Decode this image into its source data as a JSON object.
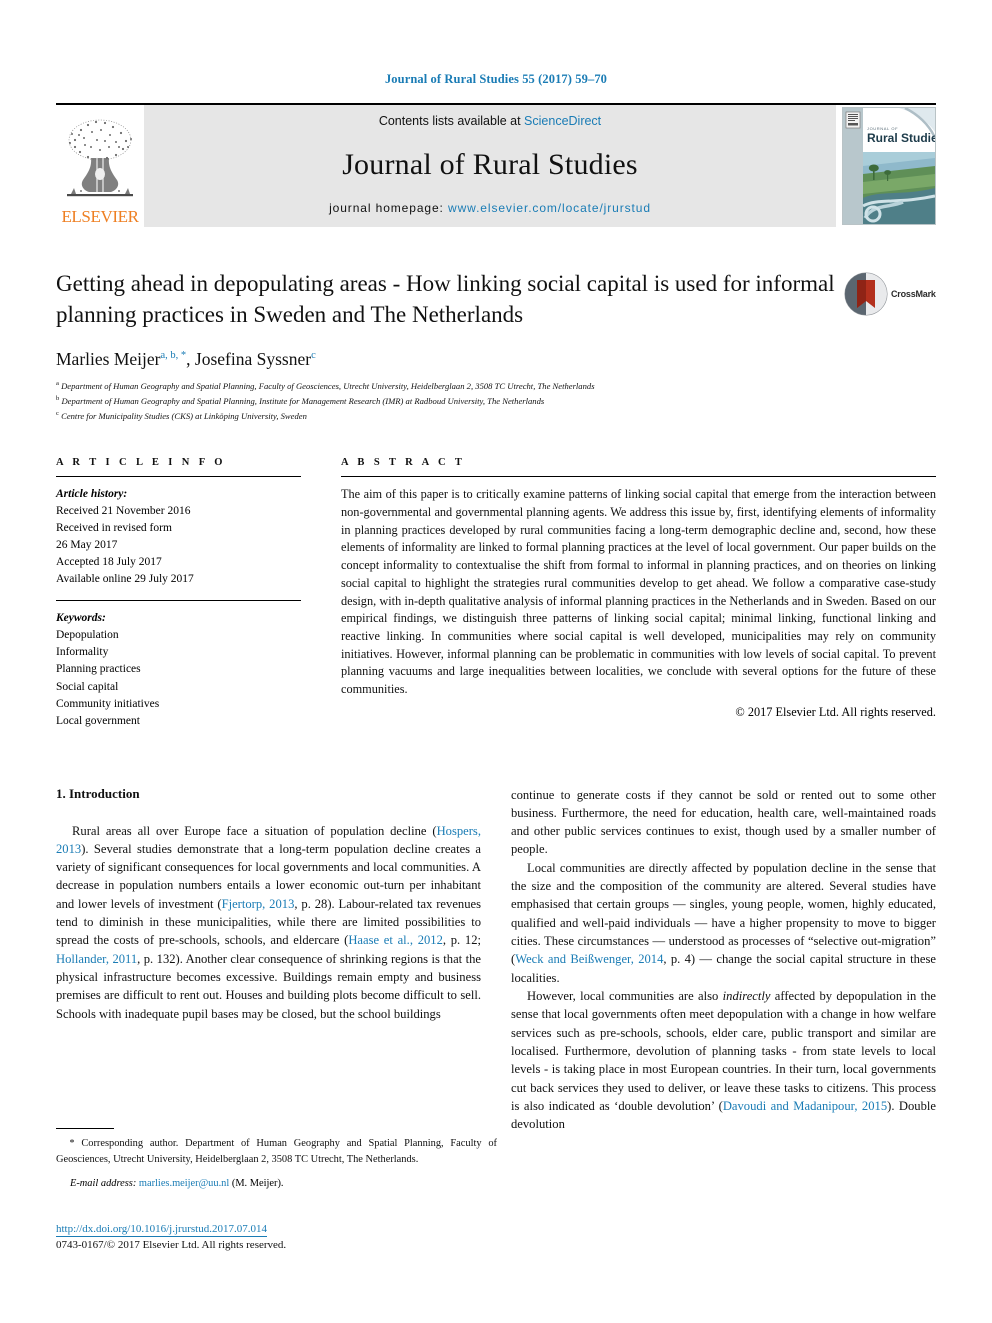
{
  "running_head": "Journal of Rural Studies 55 (2017) 59–70",
  "masthead": {
    "publisher": "ELSEVIER",
    "contents_prefix": "Contents lists available at ",
    "contents_link": "ScienceDirect",
    "journal_title": "Journal of Rural Studies",
    "homepage_prefix": "journal homepage: ",
    "homepage_url": "www.elsevier.com/locate/jrurstud",
    "cover_title": "Rural Studies",
    "cover_kicker": "JOURNAL OF"
  },
  "article": {
    "title": "Getting ahead in depopulating areas - How linking social capital is used for informal planning practices in Sweden and The Netherlands",
    "crossmark_label": "CrossMark",
    "authors": [
      {
        "name": "Marlies Meijer",
        "marks": "a, b, *"
      },
      {
        "name": "Josefina Syssner",
        "marks": "c"
      }
    ],
    "affiliations": [
      {
        "mark": "a",
        "text": "Department of Human Geography and Spatial Planning, Faculty of Geosciences, Utrecht University, Heidelberglaan 2, 3508 TC Utrecht, The Netherlands"
      },
      {
        "mark": "b",
        "text": "Department of Human Geography and Spatial Planning, Institute for Management Research (IMR) at Radboud University, The Netherlands"
      },
      {
        "mark": "c",
        "text": "Centre for Municipality Studies (CKS) at Linköping University, Sweden"
      }
    ]
  },
  "article_info": {
    "heading": "A R T I C L E   I N F O",
    "history_label": "Article history:",
    "history": [
      "Received 21 November 2016",
      "Received in revised form",
      "26 May 2017",
      "Accepted 18 July 2017",
      "Available online 29 July 2017"
    ],
    "keywords_label": "Keywords:",
    "keywords": [
      "Depopulation",
      "Informality",
      "Planning practices",
      "Social capital",
      "Community initiatives",
      "Local government"
    ]
  },
  "abstract": {
    "heading": "A B S T R A C T",
    "text": "The aim of this paper is to critically examine patterns of linking social capital that emerge from the interaction between non-governmental and governmental planning agents. We address this issue by, first, identifying elements of informality in planning practices developed by rural communities facing a long-term demographic decline and, second, how these elements of informality are linked to formal planning practices at the level of local government. Our paper builds on the concept informality to contextualise the shift from formal to informal in planning practices, and on theories on linking social capital to highlight the strategies rural communities develop to get ahead. We follow a comparative case-study design, with in-depth qualitative analysis of informal planning practices in the Netherlands and in Sweden. Based on our empirical findings, we distinguish three patterns of linking social capital; minimal linking, functional linking and reactive linking. In communities where social capital is well developed, municipalities may rely on community initiatives. However, informal planning can be problematic in communities with low levels of social capital. To prevent planning vacuums and large inequalities between localities, we conclude with several options for the future of these communities.",
    "copyright": "© 2017 Elsevier Ltd. All rights reserved."
  },
  "body": {
    "section_number_title": "1. Introduction",
    "left_paragraphs": [
      {
        "segments": [
          {
            "t": "Rural areas all over Europe face a situation of population decline (",
            "ref": false
          },
          {
            "t": "Hospers, 2013",
            "ref": true
          },
          {
            "t": "). Several studies demonstrate that a long-term population decline creates a variety of significant consequences for local governments and local communities. A decrease in population numbers entails a lower economic out-turn per inhabitant and lower levels of investment (",
            "ref": false
          },
          {
            "t": "Fjertorp, 2013",
            "ref": true
          },
          {
            "t": ", p. 28). Labour-related tax revenues tend to diminish in these municipalities, while there are limited possibilities to spread the costs of pre-schools, schools, and eldercare (",
            "ref": false
          },
          {
            "t": "Haase et al., 2012",
            "ref": true
          },
          {
            "t": ", p. 12; ",
            "ref": false
          },
          {
            "t": "Hollander, 2011",
            "ref": true
          },
          {
            "t": ", p. 132). Another clear consequence of shrinking regions is that the physical infrastructure becomes excessive. Buildings remain empty and business premises are difficult to rent out. Houses and building plots become difficult to sell. Schools with inadequate pupil bases may be closed, but the school buildings",
            "ref": false
          }
        ]
      }
    ],
    "right_paragraphs": [
      {
        "indent": false,
        "segments": [
          {
            "t": "continue to generate costs if they cannot be sold or rented out to some other business. Furthermore, the need for education, health care, well-maintained roads and other public services continues to exist, though used by a smaller number of people.",
            "ref": false
          }
        ]
      },
      {
        "indent": true,
        "segments": [
          {
            "t": "Local communities are directly affected by population decline in the sense that the size and the composition of the community are altered. Several studies have emphasised that certain groups — singles, young people, women, highly educated, qualified and well-paid individuals — have a higher propensity to move to bigger cities. These circumstances — understood as processes of “selective out-migration” (",
            "ref": false
          },
          {
            "t": "Weck and Beißwenger, 2014",
            "ref": true
          },
          {
            "t": ", p. 4) — change the social capital structure in these localities.",
            "ref": false
          }
        ]
      },
      {
        "indent": true,
        "segments": [
          {
            "t": "However, local communities are also ",
            "ref": false
          },
          {
            "t": "indirectly",
            "ref": false,
            "italic": true
          },
          {
            "t": " affected by depopulation in the sense that local governments often meet depopulation with a change in how welfare services such as pre-schools, schools, elder care, public transport and similar are localised. Furthermore, devolution of planning tasks - from state levels to local levels - is taking place in most European countries. In their turn, local governments cut back services they used to deliver, or leave these tasks to citizens. This process is also indicated as ‘double devolution’ (",
            "ref": false
          },
          {
            "t": "Davoudi and Madanipour, 2015",
            "ref": true
          },
          {
            "t": "). Double devolution",
            "ref": false
          }
        ]
      }
    ]
  },
  "footnote": {
    "star": "*",
    "text": " Corresponding author. Department of Human Geography and Spatial Planning, Faculty of Geosciences, Utrecht University, Heidelberglaan 2, 3508 TC Utrecht, The Netherlands.",
    "email_label": "E-mail address:",
    "email": "marlies.meijer@uu.nl",
    "email_suffix": " (M. Meijer)."
  },
  "doi": {
    "url": "http://dx.doi.org/10.1016/j.jrurstud.2017.07.014",
    "issn_line": "0743-0167/© 2017 Elsevier Ltd. All rights reserved."
  },
  "colors": {
    "link": "#1a7cb5",
    "elsevier_orange": "#ee7f22",
    "masthead_bg": "#e6e6e6",
    "crossmark_red": "#b3301d"
  }
}
